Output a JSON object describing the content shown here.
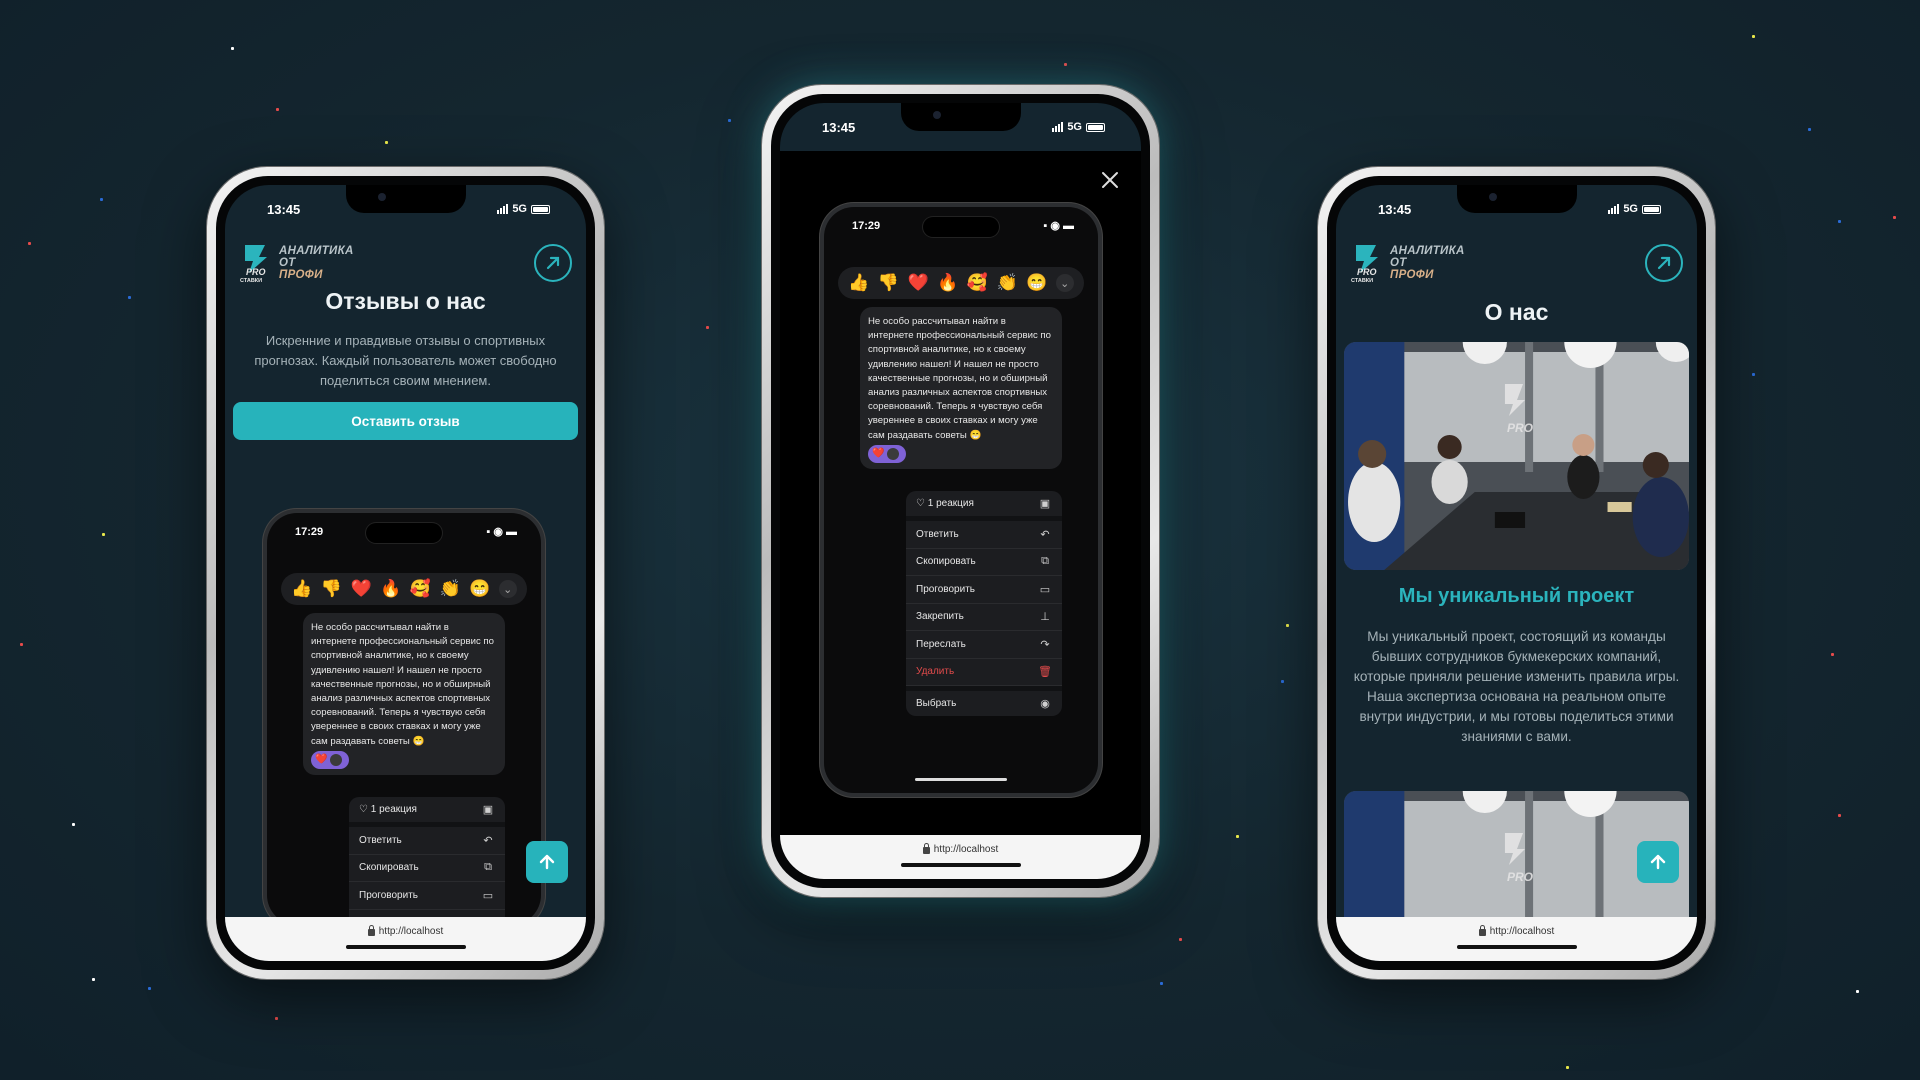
{
  "status_time": "13:45",
  "network": "5G",
  "url": "http://localhost",
  "accent_color": "#27b3bb",
  "logo": {
    "line1": "АНАЛИТИКА",
    "line2": "ОТ",
    "line3": "ПРОФИ",
    "badge": "PRO",
    "badge_sub": "СТАВКИ"
  },
  "reviews_page": {
    "title": "Отзывы о нас",
    "description": "Искренние и правдивые отзывы о спортивных прогнозах. Каждый пользователь может свободно поделиться своим мнением.",
    "cta_label": "Оставить отзыв"
  },
  "telegram_mock": {
    "time": "17:29",
    "reactions": [
      "👍",
      "👎",
      "❤️",
      "🔥",
      "🥰",
      "👏",
      "😁"
    ],
    "message": "Не особо рассчитывал найти в интернете профессиональный сервис по спортивной аналитике, но к своему удивлению нашел! И нашел не просто качественные прогнозы, но и обширный анализ различных аспектов спортивных соревнований. Теперь я чувствую себя увереннее в своих ставках и могу уже сам раздавать советы 😁",
    "reaction_count": "1 реакция",
    "menu": [
      {
        "label": "Ответить",
        "icon": "reply-icon"
      },
      {
        "label": "Скопировать",
        "icon": "copy-icon"
      },
      {
        "label": "Проговорить",
        "icon": "speak-icon"
      },
      {
        "label": "Закрепить",
        "icon": "pin-icon"
      },
      {
        "label": "Переслать",
        "icon": "forward-icon"
      },
      {
        "label": "Удалить",
        "icon": "trash-icon"
      },
      {
        "label": "Выбрать",
        "icon": "check-circle-icon"
      }
    ]
  },
  "about_page": {
    "title": "О нас",
    "subtitle": "Мы уникальный проект",
    "description": "Мы уникальный проект, состоящий из команды бывших сотрудников букмекерских компаний, которые приняли решение изменить правила игры. Наша экспертиза основана на реальном опыте внутри индустрии, и мы готовы поделиться этими знаниями с вами."
  },
  "icons": {
    "external": "arrow-up-right-icon",
    "scroll_top": "arrow-up-icon",
    "close": "close-icon"
  }
}
